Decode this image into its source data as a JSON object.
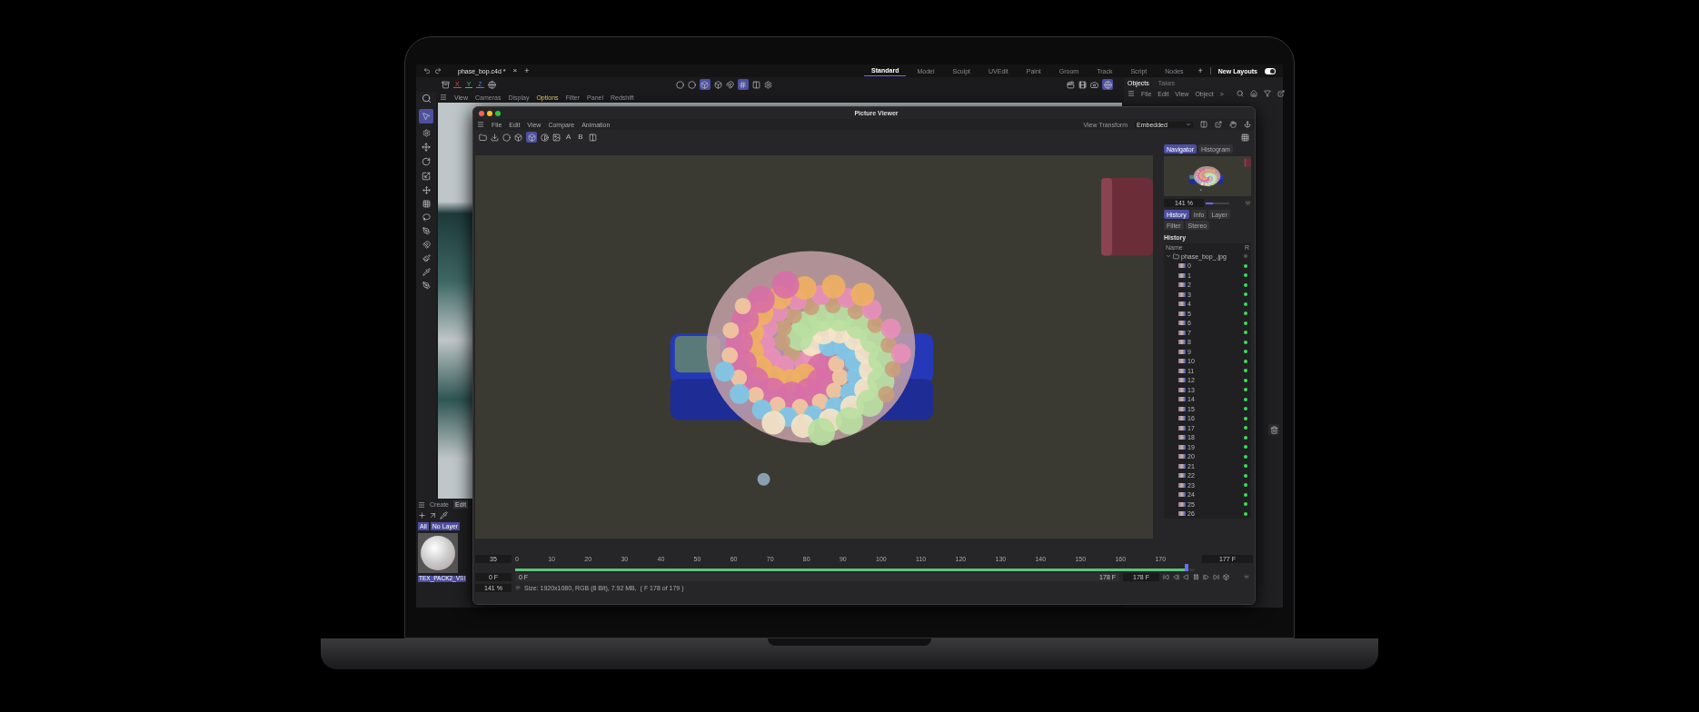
{
  "top_bar": {
    "tab": "phase_bop.c4d *",
    "tab_close": "×",
    "tab_add": "+"
  },
  "layouts": [
    {
      "label": "Standard",
      "selected": true
    },
    {
      "label": "Model",
      "selected": false
    },
    {
      "label": "Sculpt",
      "selected": false
    },
    {
      "label": "UVEdit",
      "selected": false
    },
    {
      "label": "Paint",
      "selected": false
    },
    {
      "label": "Groom",
      "selected": false
    },
    {
      "label": "Track",
      "selected": false
    },
    {
      "label": "Script",
      "selected": false
    },
    {
      "label": "Nodes",
      "selected": false
    }
  ],
  "layout_add": "+",
  "new_layouts": {
    "label": "New Layouts",
    "on": true
  },
  "axes": [
    {
      "label": "X",
      "color": "#e0404a"
    },
    {
      "label": "Y",
      "color": "#3fbf6a"
    },
    {
      "label": "Z",
      "color": "#4a7fe0"
    }
  ],
  "viewport_menu": [
    {
      "label": "View",
      "active": false
    },
    {
      "label": "Cameras",
      "active": false
    },
    {
      "label": "Display",
      "active": false
    },
    {
      "label": "Options",
      "active": true
    },
    {
      "label": "Filter",
      "active": false
    },
    {
      "label": "Panel",
      "active": false
    },
    {
      "label": "Redshift",
      "active": false
    }
  ],
  "objects_panel": {
    "tabs": [
      {
        "label": "Objects",
        "selected": true
      },
      {
        "label": "Takes",
        "selected": false
      }
    ],
    "menu": [
      "File",
      "Edit",
      "View",
      "Object",
      ">"
    ]
  },
  "material_panel": {
    "tabs": [
      {
        "label": "Create",
        "selected": false
      },
      {
        "label": "Edit",
        "selected": true
      }
    ],
    "filters": [
      "All",
      "No Layer"
    ],
    "material": "TEX_PACK2_VSI"
  },
  "picture_viewer": {
    "title": "Picture Viewer",
    "menu": [
      "File",
      "Edit",
      "View",
      "Compare",
      "Animation"
    ],
    "view_transform": {
      "label": "View Transform",
      "value": "Embedded"
    },
    "compare_letters": [
      "A",
      "B"
    ],
    "side_tabs": [
      {
        "label": "Navigator",
        "selected": true
      },
      {
        "label": "Histogram",
        "selected": false
      }
    ],
    "zoom": {
      "value": "141 %",
      "level": 0.3
    },
    "info_tabs": [
      {
        "label": "History",
        "selected": true
      },
      {
        "label": "Info",
        "selected": false
      },
      {
        "label": "Layer",
        "selected": false
      },
      {
        "label": "Filter",
        "selected": false
      },
      {
        "label": "Stereo",
        "selected": false
      }
    ],
    "history_title": "History",
    "columns": [
      "Name",
      "R"
    ],
    "tree": {
      "name": "phase_bop_.jpg",
      "expanded": true,
      "rendered": false,
      "children": [
        {
          "name": "0",
          "rendered": true
        },
        {
          "name": "1",
          "rendered": true
        },
        {
          "name": "2",
          "rendered": true
        },
        {
          "name": "3",
          "rendered": true
        },
        {
          "name": "4",
          "rendered": true
        },
        {
          "name": "5",
          "rendered": true
        },
        {
          "name": "6",
          "rendered": true
        },
        {
          "name": "7",
          "rendered": true
        },
        {
          "name": "8",
          "rendered": true
        },
        {
          "name": "9",
          "rendered": true
        },
        {
          "name": "10",
          "rendered": true
        },
        {
          "name": "11",
          "rendered": true
        },
        {
          "name": "12",
          "rendered": true
        },
        {
          "name": "13",
          "rendered": true
        },
        {
          "name": "14",
          "rendered": true
        },
        {
          "name": "15",
          "rendered": true
        },
        {
          "name": "16",
          "rendered": true
        },
        {
          "name": "17",
          "rendered": true
        },
        {
          "name": "18",
          "rendered": true
        },
        {
          "name": "19",
          "rendered": true
        },
        {
          "name": "20",
          "rendered": true
        },
        {
          "name": "21",
          "rendered": true
        },
        {
          "name": "22",
          "rendered": true
        },
        {
          "name": "23",
          "rendered": true
        },
        {
          "name": "24",
          "rendered": true
        },
        {
          "name": "25",
          "rendered": true
        },
        {
          "name": "26",
          "rendered": true
        }
      ]
    },
    "timeline": {
      "frame": "35",
      "ticks": [
        "0",
        "10",
        "20",
        "30",
        "40",
        "50",
        "60",
        "70",
        "80",
        "90",
        "100",
        "110",
        "120",
        "130",
        "140",
        "150",
        "160",
        "170"
      ],
      "level": 0.99,
      "current": "177 F"
    },
    "range": {
      "start": "0 F",
      "bar_start": "0 F",
      "bar_end": "178 F",
      "end": "178 F"
    },
    "status": {
      "zoom": "141 %",
      "info": "Size: 1920x1080, RGB (8 Bit), 7.92 MB,  ( F 178 of 179 )"
    }
  }
}
